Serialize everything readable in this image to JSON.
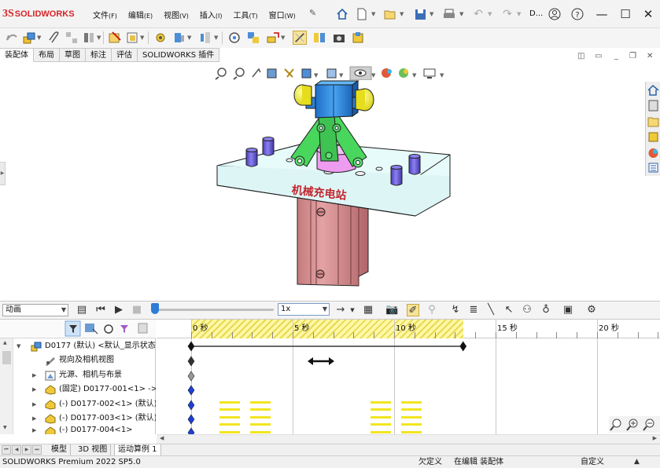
{
  "app": {
    "logo_mark": "3S",
    "logo_text": "SOLIDWORKS",
    "document_short": "D..."
  },
  "menus": [
    {
      "label": "文件",
      "key": "(F)"
    },
    {
      "label": "编辑",
      "key": "(E)"
    },
    {
      "label": "视图",
      "key": "(V)"
    },
    {
      "label": "插入",
      "key": "(I)"
    },
    {
      "label": "工具",
      "key": "(T)"
    },
    {
      "label": "窗口",
      "key": "(W)"
    }
  ],
  "title_icons": [
    "pin-icon",
    "home-icon",
    "new-document-icon",
    "open-icon",
    "save-icon",
    "print-icon",
    "undo-icon",
    "redo-icon",
    "user-icon",
    "help-icon",
    "minimize-icon",
    "maximize-icon",
    "close-icon"
  ],
  "command_tabs": [
    {
      "label": "装配体",
      "active": true
    },
    {
      "label": "布局",
      "active": false
    },
    {
      "label": "草图",
      "active": false
    },
    {
      "label": "标注",
      "active": false
    },
    {
      "label": "评估",
      "active": false
    },
    {
      "label": "SOLIDWORKS 插件",
      "active": false
    }
  ],
  "model": {
    "plate_text": "机械充电站",
    "colors": {
      "cylinder_body": "#d98a8c",
      "plate": "#e9fbfb",
      "blue_block": "#2e86de",
      "arms": "#49d65c",
      "knobs": "#f2ee2a",
      "posts": "#6e5fd6",
      "center_part": "#ee9cf0"
    }
  },
  "motion": {
    "study_type": "动画",
    "speed": "1x",
    "tree": [
      {
        "label": "D0177 (默认) <默认_显示状态",
        "icon": "assembly-icon",
        "level": 0,
        "expanded": true
      },
      {
        "label": "视向及相机视图",
        "icon": "camera-view-icon",
        "level": 1
      },
      {
        "label": "光源、相机与布景",
        "icon": "lights-icon",
        "level": 1,
        "expandable": true
      },
      {
        "label": "(固定) D0177-001<1> ->",
        "icon": "part-icon",
        "level": 1,
        "expandable": true
      },
      {
        "label": "(-) D0177-002<1> (默认)",
        "icon": "part-icon",
        "level": 1,
        "expandable": true
      },
      {
        "label": "(-) D0177-003<1> (默认)",
        "icon": "part-icon",
        "level": 1,
        "expandable": true
      },
      {
        "label": "(-) D0177-004<1>",
        "icon": "part-icon",
        "level": 1,
        "expandable": true
      }
    ],
    "timeline": {
      "unit": "秒",
      "tick_labels": [
        "0 秒",
        "5 秒",
        "10 秒",
        "15 秒",
        "20 秒"
      ],
      "tick_values": [
        0,
        5,
        10,
        15,
        20
      ],
      "hatched_until": 13.4,
      "end_time": 13.4
    }
  },
  "bottom_tabs": [
    {
      "label": "模型",
      "active": false
    },
    {
      "label": "3D 视图",
      "active": false
    },
    {
      "label": "运动算例 1",
      "active": true
    }
  ],
  "status": {
    "product": "SOLIDWORKS Premium 2022 SP5.0",
    "state": "欠定义",
    "mode": "在编辑 装配体",
    "custom": "自定义"
  }
}
